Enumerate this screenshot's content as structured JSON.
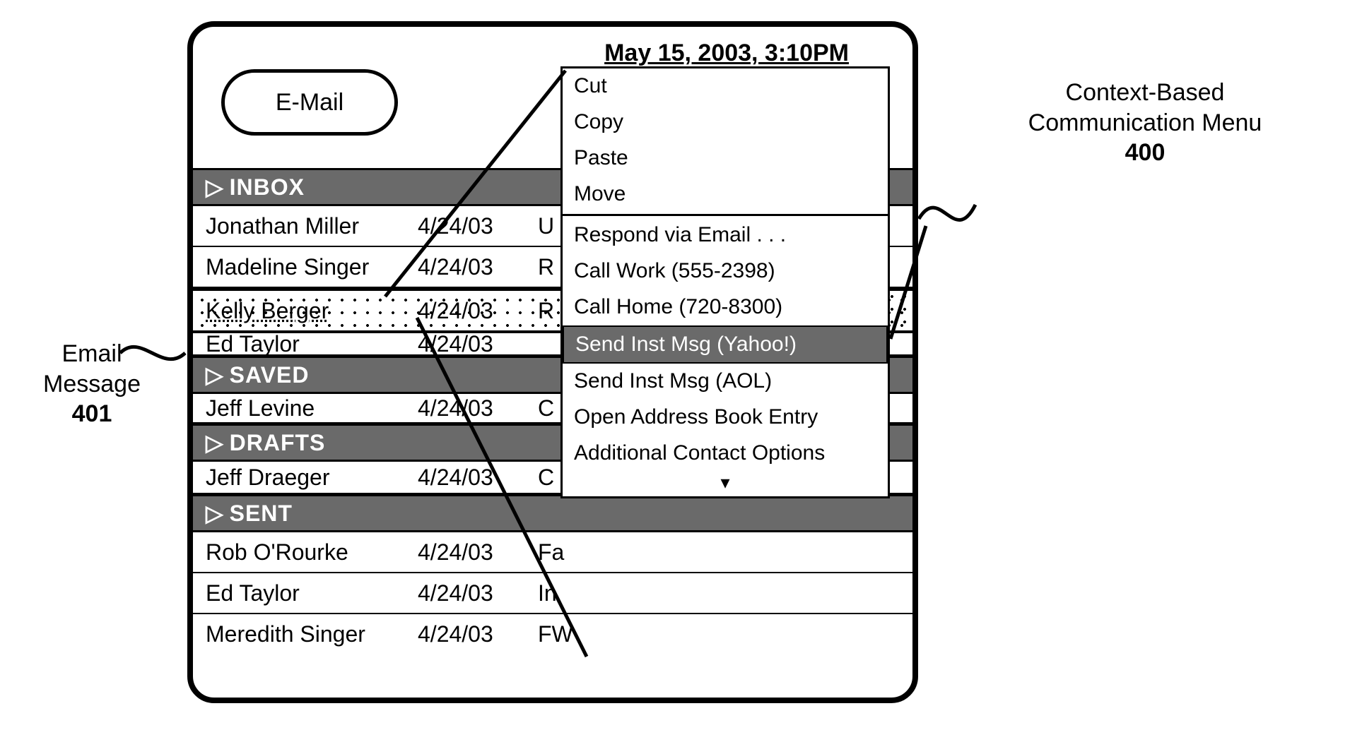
{
  "header": {
    "datetime": "May 15, 2003, 3:10PM",
    "pill_label": "E-Mail"
  },
  "folders": {
    "inbox": "INBOX",
    "saved": "SAVED",
    "drafts": "DRAFTS",
    "sent": "SENT"
  },
  "rows": {
    "inbox": [
      {
        "sender": "Jonathan Miller",
        "date": "4/24/03",
        "subj": "U"
      },
      {
        "sender": "Madeline Singer",
        "date": "4/24/03",
        "subj": "R"
      },
      {
        "sender": "Kelly Berger",
        "date": "4/24/03",
        "subj": "R"
      },
      {
        "sender": "Ed Taylor",
        "date": "4/24/03",
        "subj": ""
      }
    ],
    "saved": [
      {
        "sender": "Jeff Levine",
        "date": "4/24/03",
        "subj": "C"
      }
    ],
    "drafts": [
      {
        "sender": "Jeff Draeger",
        "date": "4/24/03",
        "subj": "C"
      }
    ],
    "sent": [
      {
        "sender": "Rob O'Rourke",
        "date": "4/24/03",
        "subj": "Fa"
      },
      {
        "sender": "Ed Taylor",
        "date": "4/24/03",
        "subj": "In"
      },
      {
        "sender": "Meredith Singer",
        "date": "4/24/03",
        "subj": "FW"
      }
    ]
  },
  "menu": {
    "items": [
      "Cut",
      "Copy",
      "Paste",
      "Move",
      "Respond via Email . . .",
      "Call Work (555-2398)",
      "Call Home (720-8300)",
      "Send Inst Msg (Yahoo!)",
      "Send Inst Msg (AOL)",
      "Open Address Book Entry",
      "Additional Contact Options"
    ],
    "selected_index": 7,
    "more_arrow": "▾"
  },
  "callouts": {
    "left_line1": "Email",
    "left_line2": "Message",
    "left_num": "401",
    "right_line1": "Context-Based",
    "right_line2": "Communication Menu",
    "right_num": "400"
  },
  "glyphs": {
    "triangle": "▷"
  }
}
